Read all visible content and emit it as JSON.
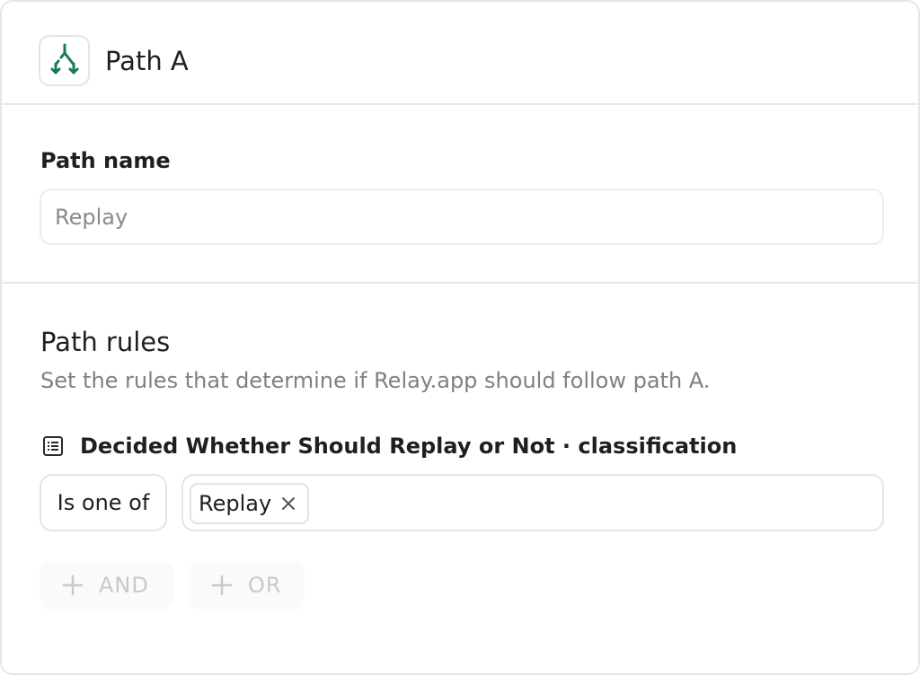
{
  "header": {
    "title": "Path A",
    "icon": "split-path-icon",
    "icon_color": "#1a7a55"
  },
  "path_name": {
    "label": "Path name",
    "placeholder": "Replay",
    "value": ""
  },
  "path_rules": {
    "title": "Path rules",
    "description": "Set the rules that determine if Relay.app should follow path A.",
    "rule": {
      "field_icon": "list-icon",
      "field_label": "Decided Whether Should Replay or Not · classification",
      "operator": "Is one of",
      "values": [
        "Replay"
      ]
    },
    "add_and_label": "AND",
    "add_or_label": "OR"
  },
  "colors": {
    "text": "#1f1f1f",
    "muted": "#808080",
    "border": "#e4e4e4",
    "disabled": "#c9c9c9",
    "brand_green": "#1a7a55"
  }
}
